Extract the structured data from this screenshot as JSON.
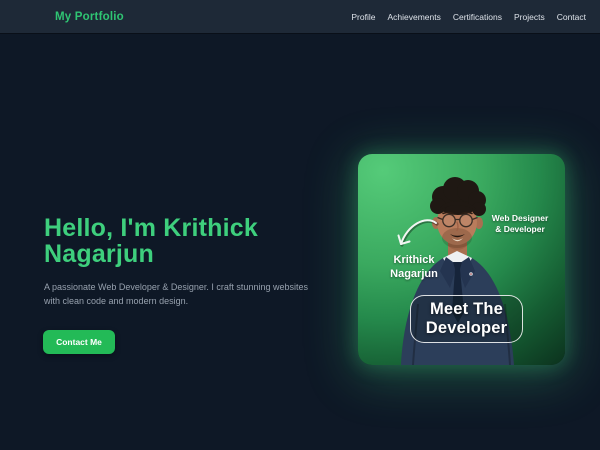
{
  "header": {
    "logo": "My Portfolio",
    "nav": [
      {
        "label": "Profile"
      },
      {
        "label": "Achievements"
      },
      {
        "label": "Certifications"
      },
      {
        "label": "Projects"
      },
      {
        "label": "Contact"
      }
    ]
  },
  "hero": {
    "heading": "Hello, I'm Krithick Nagarjun",
    "description": "A passionate Web Developer & Designer. I craft stunning websites with clean code and modern design.",
    "cta_label": "Contact Me"
  },
  "developer_card": {
    "role": {
      "line1": "Web Designer",
      "line2": "& Developer"
    },
    "name": {
      "line1": "Krithick",
      "line2": "Nagarjun"
    },
    "badge": {
      "line1": "Meet The",
      "line2": "Developer"
    }
  },
  "colors": {
    "accent_green": "#3ecf7d",
    "button_green": "#23ba57",
    "logo_green": "#2fc573",
    "page_bg": "#0e1826",
    "header_bg": "#1e2937",
    "card_green_bright": "#55cb79",
    "card_green_dark": "#0b2e1c"
  }
}
